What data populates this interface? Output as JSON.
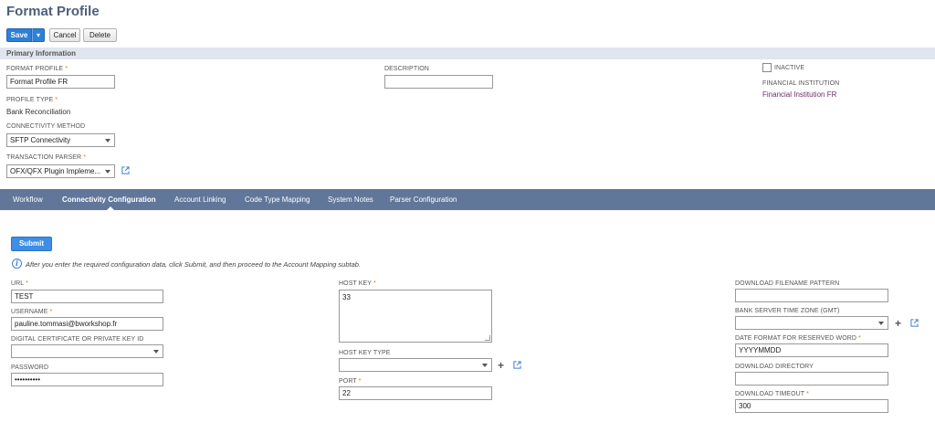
{
  "page": {
    "title": "Format Profile"
  },
  "toolbar": {
    "save": "Save",
    "save_menu": "▾",
    "cancel": "Cancel",
    "delete": "Delete"
  },
  "primary": {
    "section_title": "Primary Information",
    "format_profile": {
      "label": "FORMAT PROFILE",
      "value": "Format Profile FR"
    },
    "description": {
      "label": "DESCRIPTION",
      "value": ""
    },
    "inactive": {
      "label": "INACTIVE",
      "checked": false
    },
    "financial_institution": {
      "label": "FINANCIAL INSTITUTION",
      "value": "Financial Institution FR"
    },
    "profile_type": {
      "label": "PROFILE TYPE",
      "value": "Bank Reconciliation"
    },
    "connectivity_method": {
      "label": "CONNECTIVITY METHOD",
      "value": "SFTP Connectivity"
    },
    "transaction_parser": {
      "label": "TRANSACTION PARSER",
      "value": "OFX/QFX Plugin Impleme..."
    },
    "required_mark": "*"
  },
  "tabs": [
    {
      "label": "Workflow",
      "active": false
    },
    {
      "label": "Connectivity Configuration",
      "active": true
    },
    {
      "label": "Account Linking",
      "active": false
    },
    {
      "label": "Code Type Mapping",
      "active": false
    },
    {
      "label": "System Notes",
      "active": false
    },
    {
      "label": "Parser Configuration",
      "active": false
    }
  ],
  "connectivity": {
    "submit": "Submit",
    "info": "After you enter the required configuration data, click Submit, and then proceed to the Account Mapping subtab.",
    "url": {
      "label": "URL",
      "value": "TEST"
    },
    "username": {
      "label": "USERNAME",
      "value": "pauline.tommasi@bworkshop.fr"
    },
    "digital_certificate": {
      "label": "DIGITAL CERTIFICATE OR PRIVATE KEY ID",
      "value": ""
    },
    "password": {
      "label": "PASSWORD",
      "value": "••••••••••"
    },
    "host_key": {
      "label": "HOST KEY",
      "value": "33"
    },
    "host_key_type": {
      "label": "HOST KEY TYPE",
      "value": ""
    },
    "port": {
      "label": "PORT",
      "value": "22"
    },
    "download_filename_pattern": {
      "label": "DOWNLOAD FILENAME PATTERN",
      "value": ""
    },
    "bank_server_time_zone": {
      "label": "BANK SERVER TIME ZONE (GMT)",
      "value": ""
    },
    "date_format": {
      "label": "DATE FORMAT FOR RESERVED WORD",
      "value": "YYYYMMDD"
    },
    "download_directory": {
      "label": "DOWNLOAD DIRECTORY",
      "value": ""
    },
    "download_timeout": {
      "label": "DOWNLOAD TIMEOUT",
      "value": "300"
    }
  },
  "colors": {
    "title": "#4d5f79",
    "tabbar": "#607799",
    "primary_button": "#2f7fd7",
    "required": "#e0731a",
    "link": "#6b2e6b"
  }
}
